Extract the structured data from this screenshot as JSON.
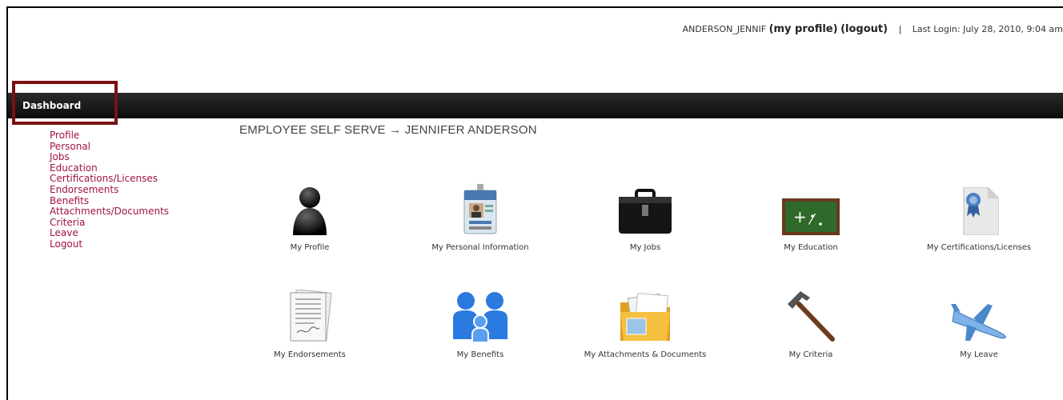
{
  "header": {
    "username": "ANDERSON_JENNIF",
    "my_profile_label": "my profile",
    "logout_label": "logout",
    "separator": "|",
    "last_login": "Last Login: July 28, 2010, 9:04 am"
  },
  "navbar": {
    "dashboard_label": "Dashboard"
  },
  "sidebar": {
    "items": [
      {
        "label": "Profile"
      },
      {
        "label": "Personal"
      },
      {
        "label": "Jobs"
      },
      {
        "label": "Education"
      },
      {
        "label": "Certifications/Licenses"
      },
      {
        "label": "Endorsements"
      },
      {
        "label": "Benefits"
      },
      {
        "label": "Attachments/Documents"
      },
      {
        "label": "Criteria"
      },
      {
        "label": "Leave"
      },
      {
        "label": "Logout"
      }
    ]
  },
  "main": {
    "title": "EMPLOYEE SELF SERVE → JENNIFER ANDERSON",
    "tiles": [
      {
        "label": "My Profile",
        "icon": "person-silhouette-icon"
      },
      {
        "label": "My Personal Information",
        "icon": "id-badge-icon"
      },
      {
        "label": "My Jobs",
        "icon": "briefcase-icon"
      },
      {
        "label": "My Education",
        "icon": "chalkboard-icon"
      },
      {
        "label": "My Certifications/Licenses",
        "icon": "certificate-ribbon-icon"
      },
      {
        "label": "My Endorsements",
        "icon": "signed-documents-icon"
      },
      {
        "label": "My Benefits",
        "icon": "family-icon"
      },
      {
        "label": "My Attachments & Documents",
        "icon": "folder-icon"
      },
      {
        "label": "My Criteria",
        "icon": "hammer-icon"
      },
      {
        "label": "My Leave",
        "icon": "airplane-icon"
      }
    ]
  },
  "colors": {
    "link": "#a0143c",
    "navbar": "#111111",
    "highlight": "#7a1016"
  }
}
